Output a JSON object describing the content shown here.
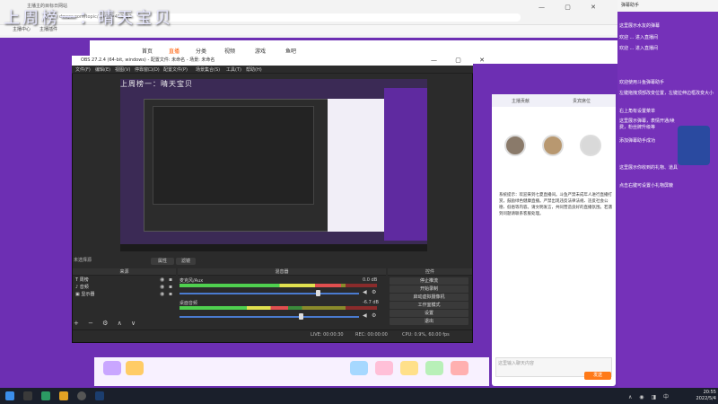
{
  "overlay_title": "上周榜一：晴天宝贝",
  "browser": {
    "tab_title": "主播主的目标日网站",
    "address": "douyu.com/topic/...?rid=453682",
    "bookmarks": [
      "主播中心",
      "主播插件"
    ],
    "window_controls": "— ▢ ✕"
  },
  "site_nav": {
    "items": [
      "首页",
      "直播",
      "分类",
      "视频",
      "游戏",
      "鱼吧"
    ]
  },
  "obs": {
    "title": "OBS 27.2.4 (64-bit, windows) - 配置文件: 未命名 - 场景: 未命名",
    "menu": [
      "文件(F)",
      "编辑(E)",
      "视图(V)",
      "停靠窗口(D)",
      "配置文件(P)",
      "场景集合(S)",
      "工具(T)",
      "帮助(H)"
    ],
    "window_controls": "— ▢ ✕",
    "preview_title": "上周榜一：晴天宝贝",
    "no_source": "未选择源",
    "props_button": "属性",
    "filters_button": "滤镜",
    "sources_header": "来源",
    "mixer_header": "混音器",
    "controls_header": "控件",
    "sources": [
      {
        "icon": "T",
        "name": "周榜"
      },
      {
        "icon": "♪",
        "name": "音频"
      },
      {
        "icon": "▣",
        "name": "显示器"
      }
    ],
    "source_toolbar": "+ − ⚙ ∧ ∨",
    "mixer": [
      {
        "name": "麦克风/Aux",
        "db": "0.0 dB",
        "level": 0.82,
        "fader": 0.78
      },
      {
        "name": "桌面音频",
        "db": "-6.7 dB",
        "level": 0.55,
        "fader": 0.68
      }
    ],
    "controls": [
      "停止推流",
      "开始录制",
      "启动虚拟摄像机",
      "工作室模式",
      "设置",
      "退出"
    ],
    "status": {
      "live": "LIVE: 00:00:30",
      "rec": "REC: 00:00:00",
      "cpu": "CPU: 0.9%, 60.00 fps"
    }
  },
  "right_panel": {
    "header": "弹幕助手",
    "lines": [
      "这里展示水友的弹幕",
      "欢迎 ... 进入直播间",
      "欢迎 ... 进入直播间",
      "欢迎使用斗鱼弹幕助手",
      "左键拖拽顶部改变位置，左键拉伸边框改变大小",
      "右上角有设置菜单",
      "这里展示弹幕，表情开通/续费，粉丝牌升级等",
      "添加弹幕助手成功",
      "这里展示你收到的礼物、道具",
      "点击右键可设置小礼物屏蔽"
    ]
  },
  "chat": {
    "tabs": [
      "主播贡献",
      "贵宾席位"
    ],
    "text": "系统提示：欢迎来到七夏直播间。斗鱼严禁未成年人进行直播打赏，鼓励绿色健康直播。严禁出现违反法律法规、违反社会公德、低俗等内容。请文明发言，共同营造良好的直播氛围。若遇到问题请联系客服处理。",
    "input_placeholder": "这里输入聊天内容",
    "send": "发送"
  },
  "taskbar": {
    "time": "20:55",
    "date": "2022/5/4",
    "tray": "∧ ◉ ◨ 中"
  }
}
